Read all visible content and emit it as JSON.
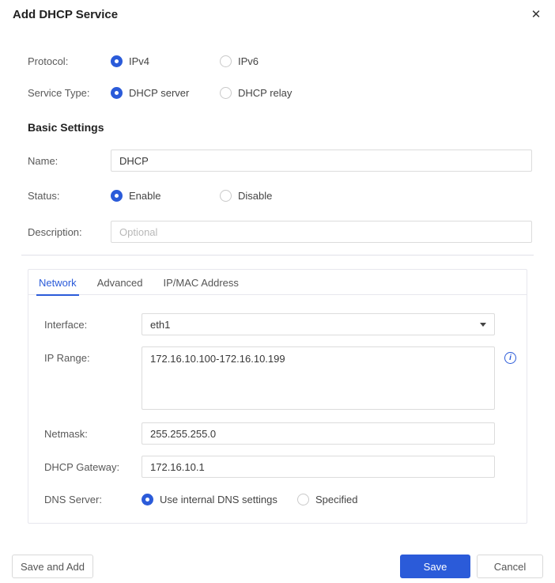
{
  "dialog": {
    "title": "Add DHCP Service"
  },
  "icons": {
    "close_glyph": "✕",
    "info_glyph": "i"
  },
  "colors": {
    "accent": "#2b5bd9",
    "border": "#dcdcdc",
    "panel_border": "#e7e7ee"
  },
  "protocol": {
    "label": "Protocol:",
    "options": [
      {
        "label": "IPv4",
        "selected": true
      },
      {
        "label": "IPv6",
        "selected": false
      }
    ]
  },
  "service_type": {
    "label": "Service Type:",
    "options": [
      {
        "label": "DHCP server",
        "selected": true
      },
      {
        "label": "DHCP relay",
        "selected": false
      }
    ]
  },
  "basic_settings": {
    "heading": "Basic Settings",
    "name": {
      "label": "Name:",
      "value": "DHCP"
    },
    "status": {
      "label": "Status:",
      "options": [
        {
          "label": "Enable",
          "selected": true
        },
        {
          "label": "Disable",
          "selected": false
        }
      ]
    },
    "description": {
      "label": "Description:",
      "value": "",
      "placeholder": "Optional"
    }
  },
  "tabs": [
    {
      "label": "Network",
      "active": true
    },
    {
      "label": "Advanced",
      "active": false
    },
    {
      "label": "IP/MAC Address",
      "active": false
    }
  ],
  "network_tab": {
    "interface": {
      "label": "Interface:",
      "value": "eth1"
    },
    "ip_range": {
      "label": "IP Range:",
      "value": "172.16.10.100-172.16.10.199"
    },
    "netmask": {
      "label": "Netmask:",
      "value": "255.255.255.0"
    },
    "dhcp_gateway": {
      "label": "DHCP Gateway:",
      "value": "172.16.10.1"
    },
    "dns_server": {
      "label": "DNS Server:",
      "options": [
        {
          "label": "Use internal DNS settings",
          "selected": true
        },
        {
          "label": "Specified",
          "selected": false
        }
      ]
    }
  },
  "footer": {
    "save_and_add_label": "Save and Add",
    "save_label": "Save",
    "cancel_label": "Cancel"
  }
}
